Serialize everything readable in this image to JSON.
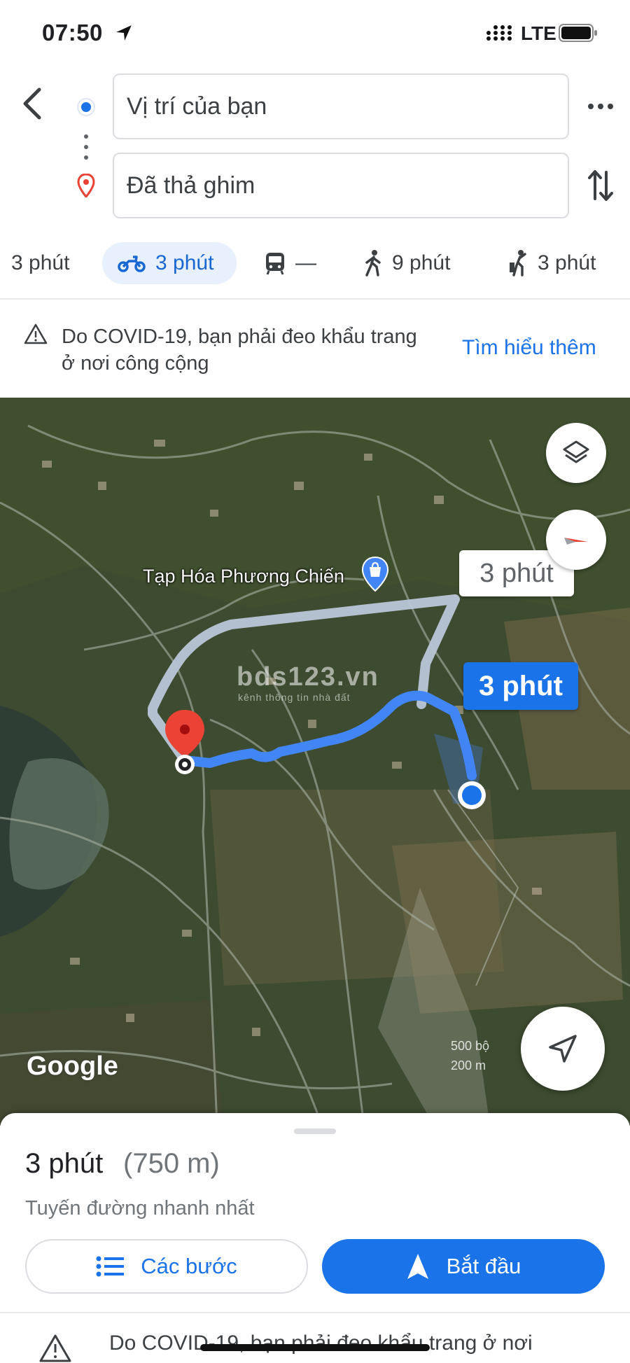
{
  "status_bar": {
    "time": "07:50",
    "network": "LTE"
  },
  "directions": {
    "origin": "Vị trí của bạn",
    "destination": "Đã thả ghim"
  },
  "modes": [
    {
      "name": "car",
      "label": "3 phút",
      "selected": false
    },
    {
      "name": "motorbike",
      "label": "3 phút",
      "selected": true
    },
    {
      "name": "transit",
      "label": "—",
      "selected": false
    },
    {
      "name": "walk",
      "label": "9 phút",
      "selected": false
    },
    {
      "name": "ride",
      "label": "3 phút",
      "selected": false
    }
  ],
  "covid_banner": {
    "text": "Do COVID-19, bạn phải đeo khẩu trang ở nơi công cộng",
    "link": "Tìm hiểu thêm"
  },
  "map": {
    "place_label": "Tạp Hóa Phương Chiến",
    "alt_route_time": "3 phút",
    "route_time": "3 phút",
    "watermark": "bds123.vn",
    "watermark_sub": "kênh thông tin nhà đất",
    "logo": "Google",
    "scale_top": "500 bộ",
    "scale_bottom": "200 m",
    "colors": {
      "route": "#4285f4",
      "alt_route": "#b9c6d8",
      "pin": "#ea4335"
    }
  },
  "sheet": {
    "duration": "3 phút",
    "distance": "(750 m)",
    "description": "Tuyến đường nhanh nhất",
    "steps_button": "Các bước",
    "start_button": "Bắt đầu",
    "covid_text": "Do COVID-19, bạn phải đeo khẩu trang ở nơi"
  }
}
